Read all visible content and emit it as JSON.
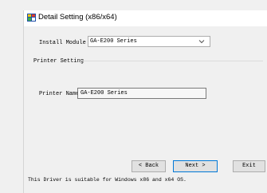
{
  "window": {
    "title": "Detail Setting (x86/x64)"
  },
  "install_module": {
    "label": "Install Module",
    "selected": "GA-E200 Series"
  },
  "printer_setting": {
    "group_label": "Printer Setting",
    "name_label": "Printer Name",
    "name_value": "GA-E200 Series"
  },
  "buttons": {
    "back": "< Back",
    "next": "Next >",
    "exit": "Exit"
  },
  "footer": {
    "text": "This Driver is suitable for Windows x86 and x64 OS."
  },
  "icons": {
    "app": "printer-setup-icon",
    "dropdown": "chevron-down-icon"
  }
}
